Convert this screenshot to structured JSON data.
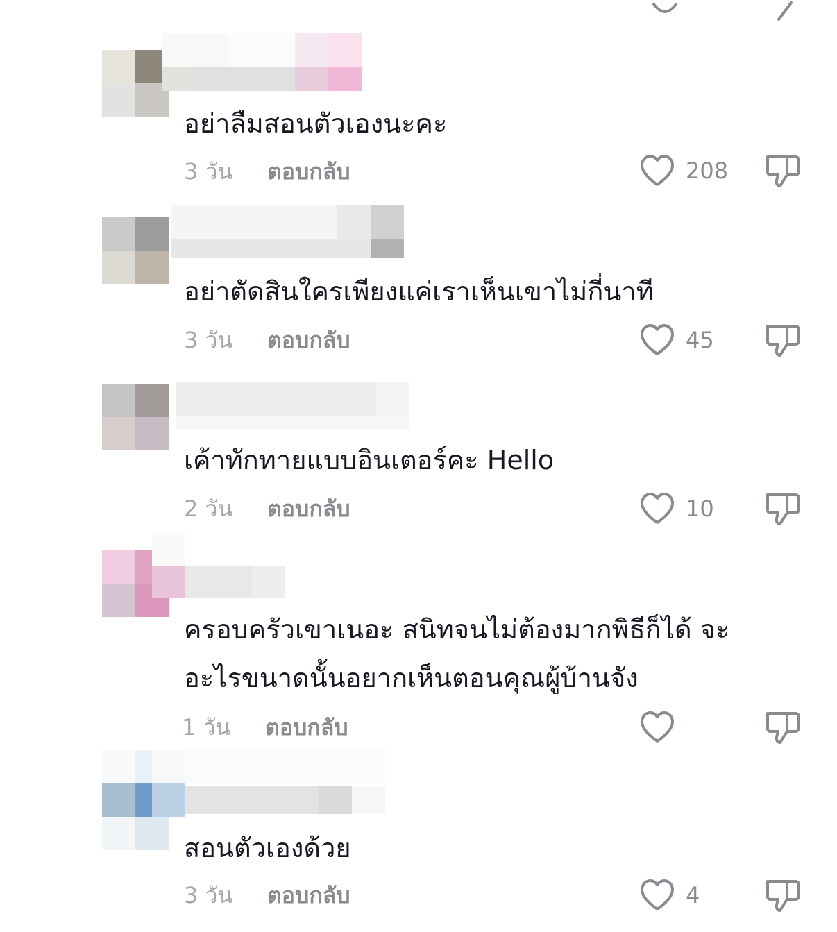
{
  "comments": [
    {
      "text_lines": [
        "อย่าลืมสอนตัวเองนะคะ"
      ],
      "time": "3 วัน",
      "reply_label": "ตอบกลับ",
      "likes": "208"
    },
    {
      "text_lines": [
        "อย่าตัดสินใครเพียงแค่เราเห็นเขาไม่กี่นาที"
      ],
      "time": "3 วัน",
      "reply_label": "ตอบกลับ",
      "likes": "45"
    },
    {
      "text_lines": [
        "เค้าทักทายแบบอินเตอร์คะ Hello"
      ],
      "time": "2 วัน",
      "reply_label": "ตอบกลับ",
      "likes": "10"
    },
    {
      "text_lines": [
        "ครอบครัวเขาเนอะ สนิทจนไม่ต้องมากพิธีก็ได้ จะ",
        "อะไรขนาดนั้นอยากเห็นตอนคุณผู้บ้านจัง"
      ],
      "time": "1 วัน",
      "reply_label": "ตอบกลับ",
      "likes": ""
    },
    {
      "text_lines": [
        "สอนตัวเองด้วย"
      ],
      "time": "3 วัน",
      "reply_label": "ตอบกลับ",
      "likes": "4"
    }
  ],
  "icons": {
    "like": "heart-outline-icon",
    "dislike": "thumbs-down-outline-icon"
  },
  "colors": {
    "text": "#161823",
    "meta": "#a5a6aa",
    "icon": "#8a8b91"
  }
}
